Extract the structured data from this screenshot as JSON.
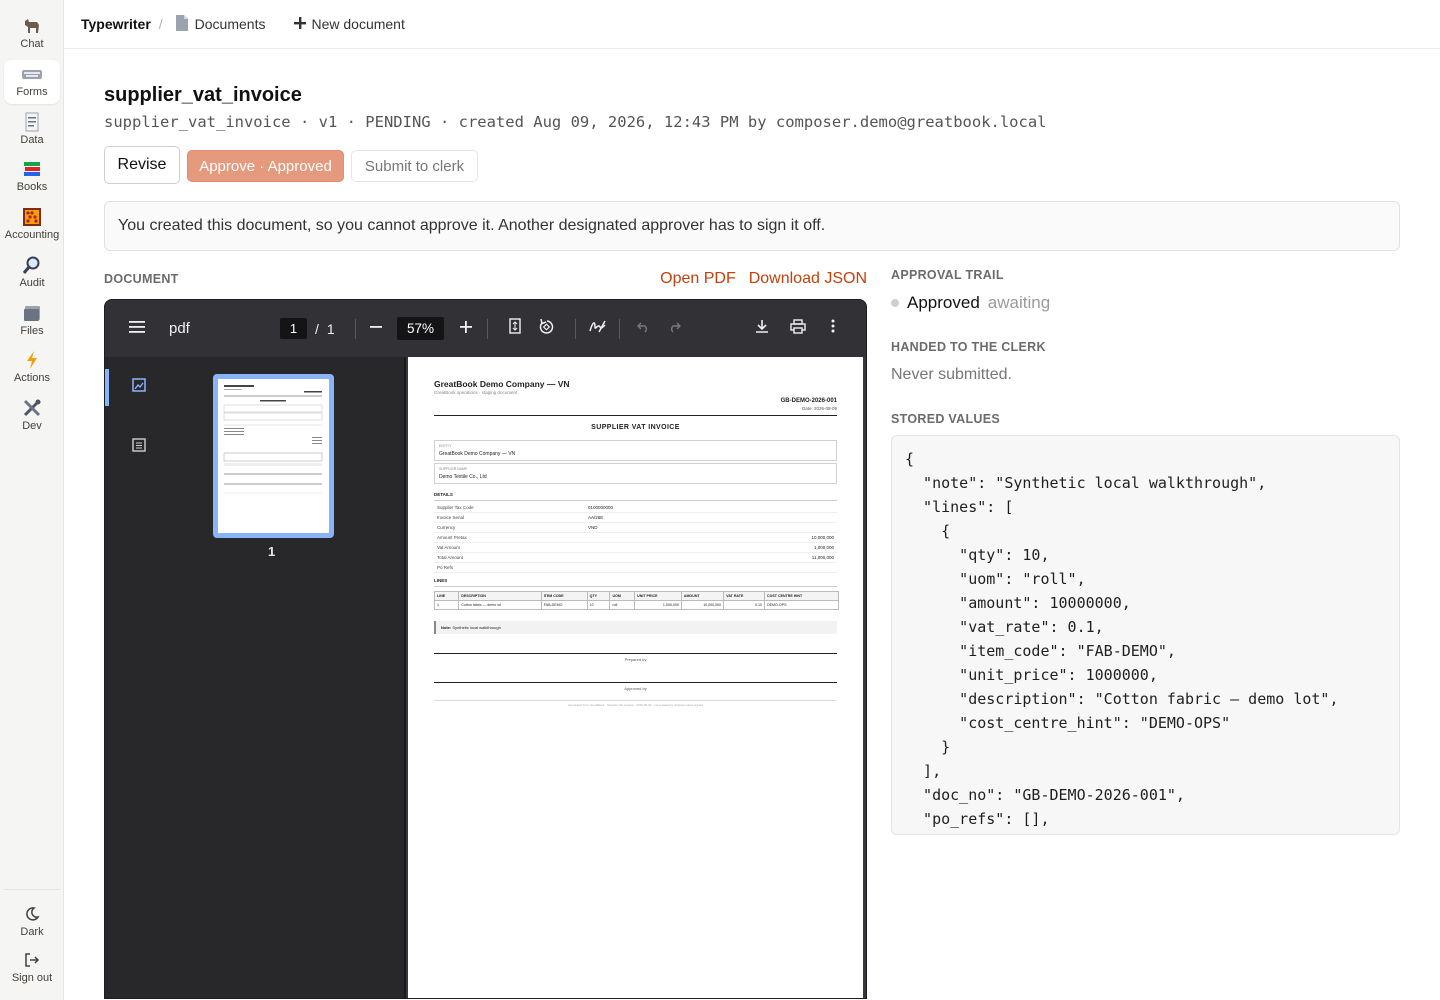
{
  "rail": {
    "items": [
      {
        "label": "Chat",
        "icon": "llama-icon"
      },
      {
        "label": "Forms",
        "icon": "keyboard-icon"
      },
      {
        "label": "Data",
        "icon": "receipt-icon"
      },
      {
        "label": "Books",
        "icon": "books-icon"
      },
      {
        "label": "Accounting",
        "icon": "abacus-icon"
      },
      {
        "label": "Audit",
        "icon": "magnifier-icon"
      },
      {
        "label": "Files",
        "icon": "folder-icon"
      },
      {
        "label": "Actions",
        "icon": "lightning-icon"
      },
      {
        "label": "Dev",
        "icon": "tools-icon"
      }
    ],
    "bottom": [
      {
        "label": "Dark",
        "icon": "moon-icon"
      },
      {
        "label": "Sign out",
        "icon": "sign-out-icon"
      }
    ],
    "active": "Forms"
  },
  "topbar": {
    "brand": "Typewriter",
    "separator": "/",
    "documents": "Documents",
    "new_document": "New document"
  },
  "header": {
    "title": "supplier_vat_invoice",
    "meta": "supplier_vat_invoice · v1 · PENDING · created Aug 09, 2026, 12:43 PM by composer.demo@greatbook.local"
  },
  "actions": {
    "revise": "Revise",
    "approve": "Approve · Approved",
    "submit": "Submit to clerk"
  },
  "notice": "You created this document, so you cannot approve it. Another designated approver has to sign it off.",
  "document": {
    "label": "DOCUMENT",
    "open_pdf": "Open PDF",
    "download_json": "Download JSON"
  },
  "viewer": {
    "title": "pdf",
    "page_current": "1",
    "page_sep": "/",
    "page_total": "1",
    "zoom": "57%",
    "thumb_label": "1"
  },
  "pdf": {
    "company": "GreatBook Demo Company — VN",
    "subtitle": "GreatBook operations · staging document",
    "doc_no": "GB-DEMO-2026-001",
    "date": "Date: 2026-08-09",
    "heading": "SUPPLIER VAT INVOICE",
    "entity_key": "ENTITY",
    "entity_val": "GreatBook Demo Company — VN",
    "supplier_key": "SUPPLIER NAME",
    "supplier_val": "Demo Textile Co., Ltd",
    "details_label": "DETAILS",
    "details": [
      {
        "k": "Supplier Tax Code",
        "v": "0100000000"
      },
      {
        "k": "Invoice Serial",
        "v": "AA/26E"
      },
      {
        "k": "Currency",
        "v": "VND"
      },
      {
        "k": "Amount Pretax",
        "v": "10,000,000"
      },
      {
        "k": "Vat Amount",
        "v": "1,000,000"
      },
      {
        "k": "Total Amount",
        "v": "11,000,000"
      },
      {
        "k": "Po Refs",
        "v": ""
      }
    ],
    "lines_label": "LINES",
    "table_headers": [
      "LINE",
      "DESCRIPTION",
      "ITEM CODE",
      "QTY",
      "UOM",
      "UNIT PRICE",
      "AMOUNT",
      "VAT RATE",
      "COST CENTRE HINT"
    ],
    "table_row": [
      "1",
      "Cotton fabric — demo lot",
      "FAB-DEMO",
      "10",
      "roll",
      "1,000,000",
      "10,000,000",
      "0.10",
      "DEMO-OPS"
    ],
    "note_label": "Note:",
    "note_text": "Synthetic local walkthrough",
    "prepared_by": "Prepared by",
    "approved_by": "Approved by",
    "footer": "Generated from GreatBook · Supplier Vat Invoice · 2026-08-09 · not a statutory original unless signed"
  },
  "right": {
    "trail_label": "APPROVAL TRAIL",
    "trail_status": "Approved",
    "trail_sub": "awaiting",
    "clerk_label": "HANDED TO THE CLERK",
    "clerk_text": "Never submitted.",
    "stored_label": "STORED VALUES",
    "stored_json": "{\n  \"note\": \"Synthetic local walkthrough\",\n  \"lines\": [\n    {\n      \"qty\": 10,\n      \"uom\": \"roll\",\n      \"amount\": 10000000,\n      \"vat_rate\": 0.1,\n      \"item_code\": \"FAB-DEMO\",\n      \"unit_price\": 1000000,\n      \"description\": \"Cotton fabric — demo lot\",\n      \"cost_centre_hint\": \"DEMO-OPS\"\n    }\n  ],\n  \"doc_no\": \"GB-DEMO-2026-001\",\n  \"po_refs\": [],"
  },
  "colors": {
    "accent_link": "#c2410c",
    "approve_bg": "#e59a7e",
    "viewer_bg": "#2a2a2e",
    "thumb_border": "#8ab4f8"
  }
}
